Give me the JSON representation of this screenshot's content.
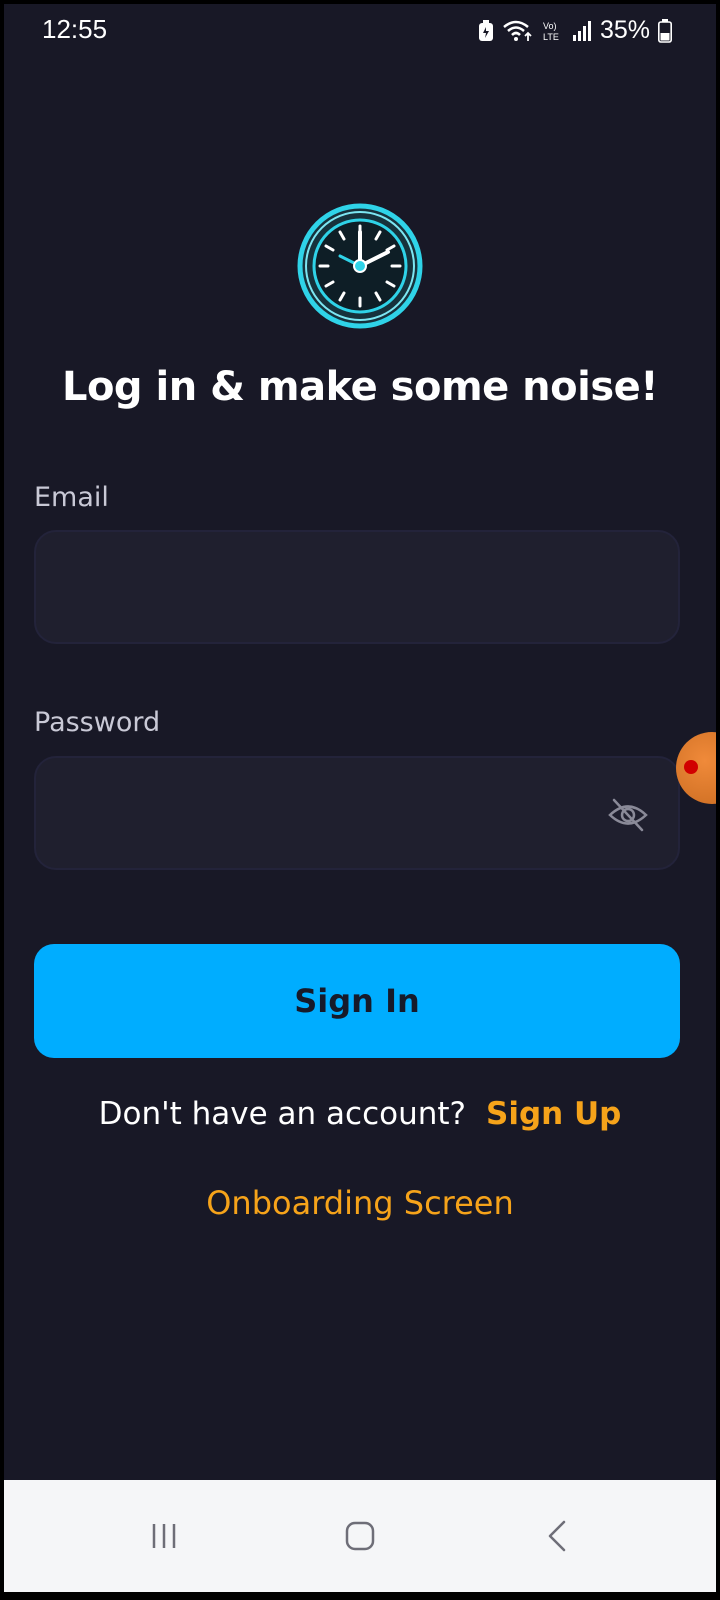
{
  "status_bar": {
    "time": "12:55",
    "battery_percent": "35%",
    "icons": [
      "battery-saver-icon",
      "wifi-icon",
      "volte-icon",
      "signal-icon",
      "battery-icon"
    ]
  },
  "logo": {
    "icon": "clock-icon",
    "accent_color": "#2fd3e8"
  },
  "page": {
    "title": "Log in & make some noise!"
  },
  "form": {
    "email": {
      "label": "Email",
      "value": "",
      "placeholder": ""
    },
    "password": {
      "label": "Password",
      "value": "",
      "placeholder": "",
      "toggle_icon": "eye-off-icon"
    },
    "sign_in_label": "Sign In"
  },
  "signup": {
    "question": "Don't have an account?",
    "link_label": "Sign Up"
  },
  "onboarding_link": "Onboarding Screen",
  "colors": {
    "background": "#181826",
    "primary_button": "#00adff",
    "link": "#f6a31a",
    "input_bg": "#1f1f2e"
  },
  "nav_bar": {
    "buttons": [
      "recents-icon",
      "home-icon",
      "back-icon"
    ]
  }
}
